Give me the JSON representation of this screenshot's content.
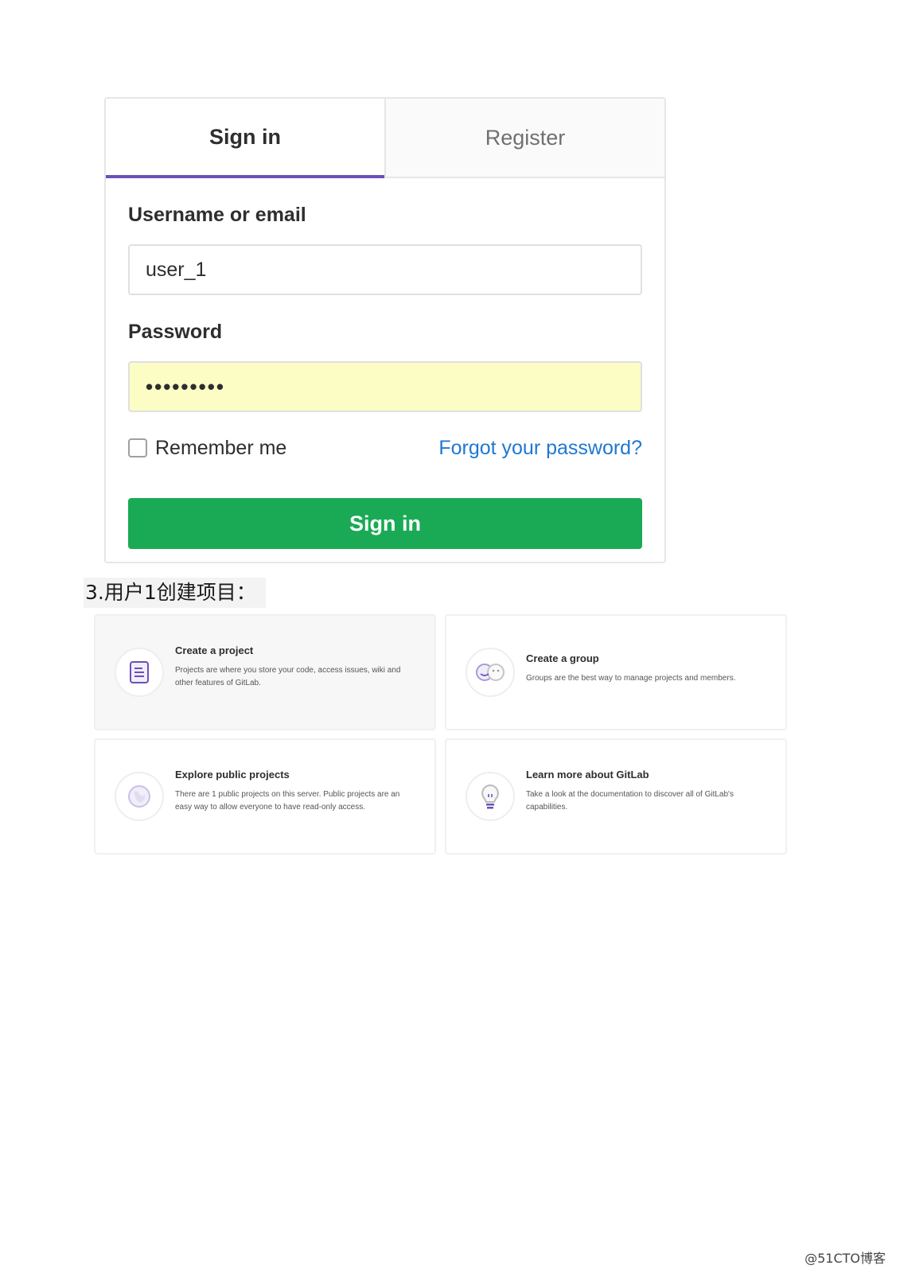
{
  "login": {
    "tabs": {
      "signin": "Sign in",
      "register": "Register"
    },
    "username": {
      "label": "Username or email",
      "value": "user_1"
    },
    "password": {
      "label": "Password",
      "value": "•••••••••"
    },
    "remember_label": "Remember me",
    "forgot_link": "Forgot your password?",
    "submit_label": "Sign in"
  },
  "step_heading": "3.用户1创建项目：",
  "cards": [
    {
      "icon": "project-icon",
      "title": "Create a project",
      "description": "Projects are where you store your code, access issues, wiki and other features of GitLab."
    },
    {
      "icon": "group-icon",
      "title": "Create a group",
      "description": "Groups are the best way to manage projects and members."
    },
    {
      "icon": "globe-icon",
      "title": "Explore public projects",
      "description": "There are 1 public projects on this server. Public projects are an easy way to allow everyone to have read-only access."
    },
    {
      "icon": "lightbulb-icon",
      "title": "Learn more about GitLab",
      "description": "Take a look at the documentation to discover all of GitLab's capabilities."
    }
  ],
  "watermark": "@51CTO博客",
  "colors": {
    "tab_accent": "#6b4fbb",
    "button_green": "#1aaa55",
    "link_blue": "#1f78d1",
    "password_autofill": "#fbfdc4",
    "icon_purple": "#6b4fbb"
  }
}
